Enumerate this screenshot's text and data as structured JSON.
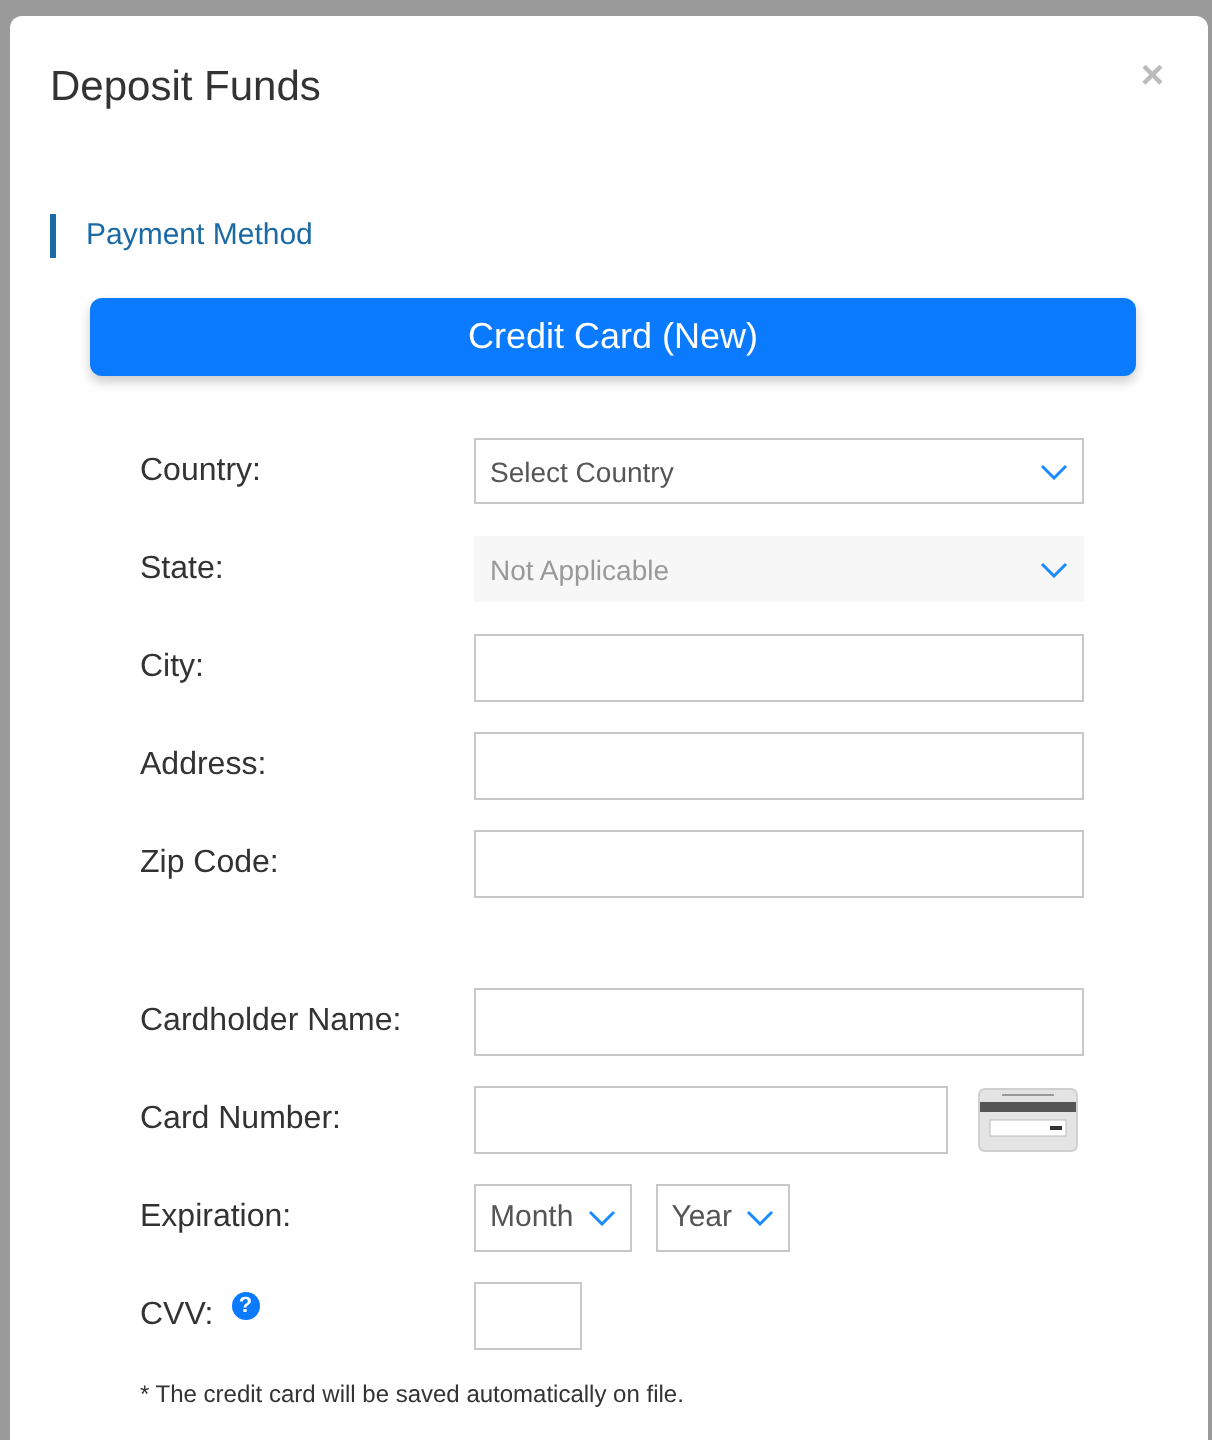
{
  "dialog": {
    "title": "Deposit Funds",
    "close": "×"
  },
  "section_heading": "Payment Method",
  "method_button": "Credit Card (New)",
  "groups": [
    {
      "fields": [
        {
          "kind": "select",
          "label": "Country:",
          "value": "Select Country",
          "disabled": false
        },
        {
          "kind": "select",
          "label": "State:",
          "value": "Not Applicable",
          "disabled": true
        },
        {
          "kind": "text",
          "label": "City:"
        },
        {
          "kind": "text",
          "label": "Address:"
        },
        {
          "kind": "text",
          "label": "Zip Code:"
        }
      ]
    },
    {
      "fields": [
        {
          "kind": "text",
          "label": "Cardholder Name:"
        },
        {
          "kind": "card",
          "label": "Card Number:"
        },
        {
          "kind": "expiry",
          "label": "Expiration:",
          "month": "Month",
          "year": "Year"
        },
        {
          "kind": "cvv",
          "label": "CVV:",
          "help": "?"
        }
      ]
    }
  ],
  "note": "* The credit card will be saved automatically on file."
}
